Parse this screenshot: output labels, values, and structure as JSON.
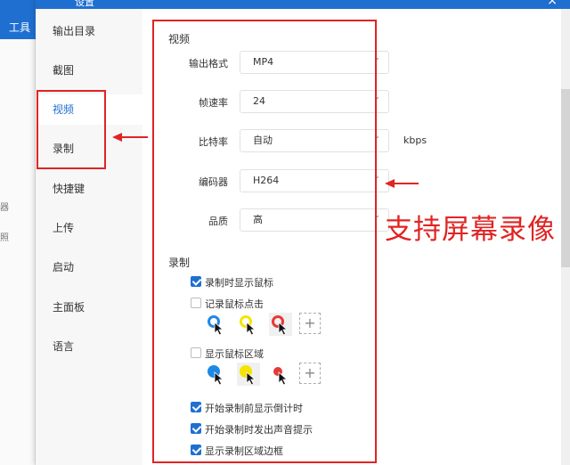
{
  "background": {
    "tools_label": "工具",
    "side_text_1": "器",
    "side_text_2": "照"
  },
  "dialog": {
    "title": "设置",
    "close": "×"
  },
  "nav": [
    {
      "label": "输出目录",
      "active": false
    },
    {
      "label": "截图",
      "active": false
    },
    {
      "label": "视频",
      "active": true
    },
    {
      "label": "录制",
      "active": false
    },
    {
      "label": "快捷键",
      "active": false
    },
    {
      "label": "上传",
      "active": false
    },
    {
      "label": "启动",
      "active": false
    },
    {
      "label": "主面板",
      "active": false
    },
    {
      "label": "语言",
      "active": false
    }
  ],
  "video": {
    "title": "视频",
    "format": {
      "label": "输出格式",
      "value": "MP4"
    },
    "fps": {
      "label": "帧速率",
      "value": "24"
    },
    "bitrate": {
      "label": "比特率",
      "value": "自动",
      "unit": "kbps"
    },
    "encoder": {
      "label": "编码器",
      "value": "H264"
    },
    "quality": {
      "label": "品质",
      "value": "高"
    }
  },
  "record": {
    "title": "录制",
    "show_cursor": {
      "label": "录制时显示鼠标",
      "checked": true
    },
    "record_clicks": {
      "label": "记录鼠标点击",
      "checked": false
    },
    "show_area": {
      "label": "显示鼠标区域",
      "checked": false
    },
    "countdown": {
      "label": "开始录制前显示倒计时",
      "checked": true
    },
    "sound": {
      "label": "开始录制时发出声音提示",
      "checked": true
    },
    "border": {
      "label": "显示录制区域边框",
      "checked": true
    },
    "add_symbol": "+"
  },
  "annotation": {
    "caption": "支持屏幕录像",
    "color": "#e02424"
  },
  "colors": {
    "accent": "#1f6fd1",
    "blue_cursor": "#1e88e5",
    "yellow_cursor": "#f5e400",
    "red_cursor": "#e53935"
  }
}
